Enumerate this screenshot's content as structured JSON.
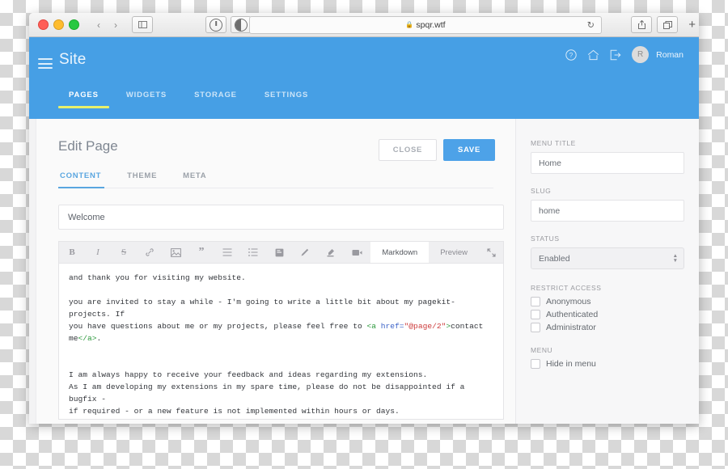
{
  "browser": {
    "url": "spqr.wtf",
    "lock_icon": "lock-icon",
    "back_icon": "‹",
    "forward_icon": "›",
    "sidebar_icon": "sidebar-icon",
    "reload_icon": "↻",
    "share_icon": "share-icon",
    "tabs_icon": "tabs-icon",
    "newtab_icon": "+"
  },
  "header": {
    "title": "Site",
    "tabs": [
      {
        "label": "PAGES",
        "active": true
      },
      {
        "label": "WIDGETS",
        "active": false
      },
      {
        "label": "STORAGE",
        "active": false
      },
      {
        "label": "SETTINGS",
        "active": false
      }
    ],
    "user": {
      "initial": "R",
      "name": "Roman"
    },
    "icons": [
      "help-icon",
      "home-icon",
      "logout-icon"
    ],
    "accent": "#469fe5",
    "active_underline": "#e8f06a"
  },
  "page": {
    "title": "Edit Page",
    "close_label": "CLOSE",
    "save_label": "SAVE",
    "tabs": [
      {
        "label": "CONTENT",
        "active": true
      },
      {
        "label": "THEME",
        "active": false
      },
      {
        "label": "META",
        "active": false
      }
    ]
  },
  "editor": {
    "title_value": "Welcome",
    "toolbar_icons": [
      "bold-icon",
      "italic-icon",
      "strikethrough-icon",
      "link-icon",
      "image-icon",
      "quote-icon",
      "unordered-list-icon",
      "ordered-list-icon",
      "book-icon",
      "pencil-icon",
      "marker-icon",
      "video-icon"
    ],
    "mode_markdown": "Markdown",
    "mode_preview": "Preview",
    "expand_icon": "expand-icon",
    "content": {
      "line1": "and thank you for visiting my website.",
      "para2_a": "you are invited to stay a while - I'm going to write a little bit about my pagekit-projects. If\nyou have questions about me or my projects, please feel free to ",
      "para2_tag_open": "<a ",
      "para2_attr": "href=",
      "para2_str": "\"@page/2\"",
      "para2_gt": ">",
      "para2_b": "contact\nme",
      "para2_tag_close": "</a>",
      "para2_c": ".",
      "para3": "I am always happy to receive your feedback and ideas regarding my extensions.\nAs I am developing my extensions in my spare time, please do not be disappointed if a bugfix -\nif required - or a new feature is not implemented within hours or days."
    }
  },
  "sidebar": {
    "menu_title_label": "MENU TITLE",
    "menu_title_value": "Home",
    "slug_label": "SLUG",
    "slug_value": "home",
    "status_label": "STATUS",
    "status_value": "Enabled",
    "restrict_label": "RESTRICT ACCESS",
    "restrict_options": [
      {
        "label": "Anonymous",
        "checked": false
      },
      {
        "label": "Authenticated",
        "checked": false
      },
      {
        "label": "Administrator",
        "checked": false
      }
    ],
    "menu_label": "MENU",
    "menu_options": [
      {
        "label": "Hide in menu",
        "checked": false
      }
    ]
  }
}
